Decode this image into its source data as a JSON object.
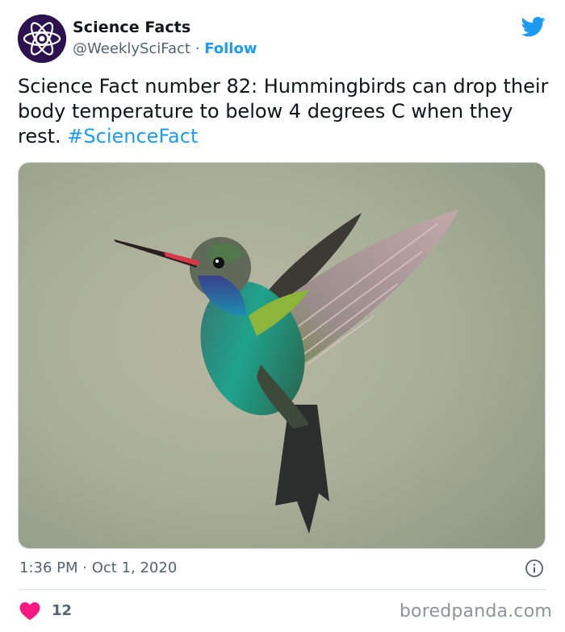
{
  "account": {
    "display_name": "Science Facts",
    "handle": "@WeeklySciFact",
    "separator": "·",
    "follow_label": "Follow"
  },
  "tweet": {
    "text": "Science Fact number 82: Hummingbirds can drop their body temperature to below 4 degrees C when they rest.",
    "hashtag": "#ScienceFact",
    "time": "1:36 PM",
    "date_separator": "·",
    "date": "Oct 1, 2020"
  },
  "engagement": {
    "likes": "12"
  },
  "watermark": "boredpanda.com",
  "icons": {
    "platform": "twitter-bird-icon",
    "info": "info-icon",
    "like": "heart-icon",
    "avatar": "atom-icon"
  },
  "colors": {
    "link": "#1d9bf0",
    "heart": "#f91880",
    "avatar_bg": "#2d1250"
  }
}
